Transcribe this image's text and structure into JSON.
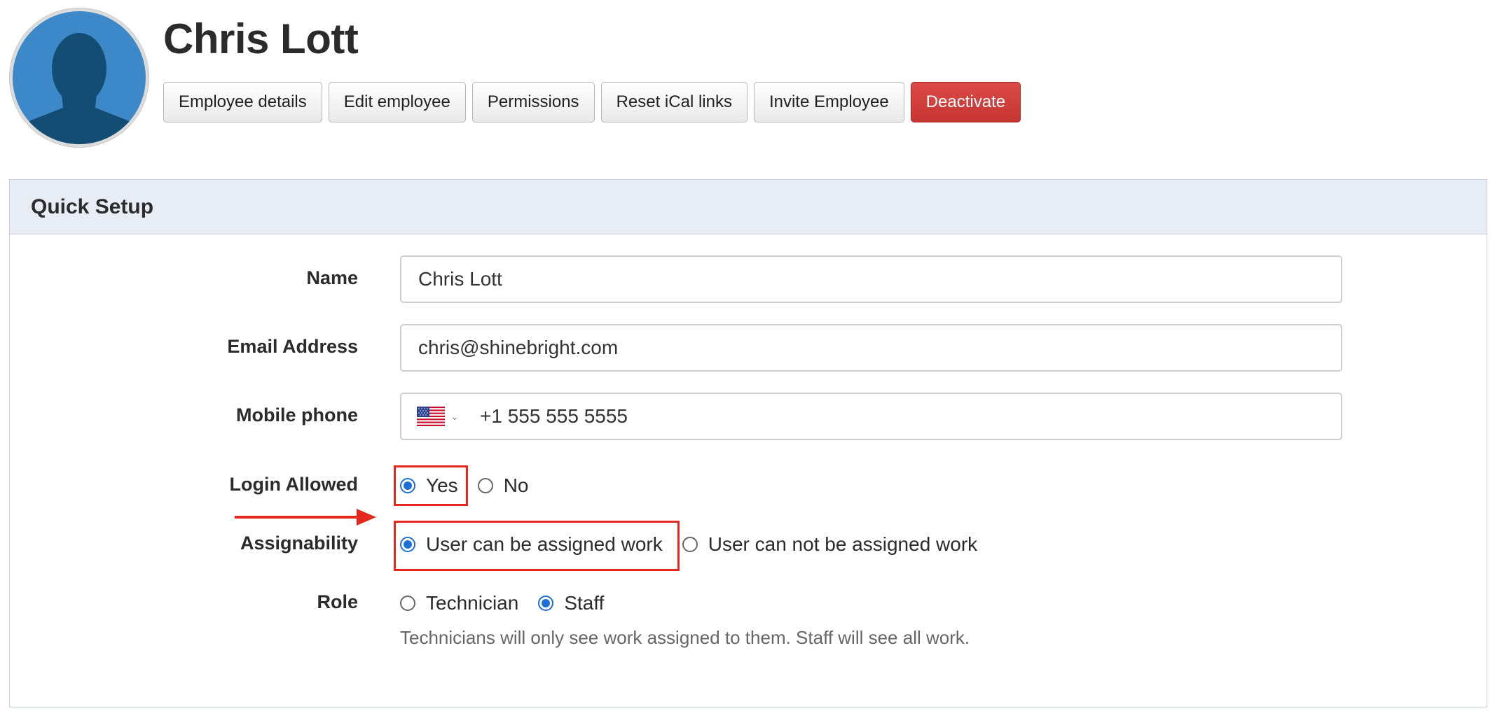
{
  "employee": {
    "name": "Chris Lott"
  },
  "actions": {
    "details": "Employee details",
    "edit": "Edit employee",
    "permissions": "Permissions",
    "reset_ical": "Reset iCal links",
    "invite": "Invite Employee",
    "deactivate": "Deactivate"
  },
  "quick_setup": {
    "title": "Quick Setup",
    "name": {
      "label": "Name",
      "value": "Chris Lott"
    },
    "email": {
      "label": "Email Address",
      "value": "chris@shinebright.com"
    },
    "mobile": {
      "label": "Mobile phone",
      "country_icon": "us-flag-icon",
      "value": "+1 555 555 5555"
    },
    "login": {
      "label": "Login Allowed",
      "options": [
        "Yes",
        "No"
      ],
      "selected": "Yes"
    },
    "assignability": {
      "label": "Assignability",
      "options": [
        "User can be assigned work",
        "User can not be assigned work"
      ],
      "selected": "User can be assigned work"
    },
    "role": {
      "label": "Role",
      "options": [
        "Technician",
        "Staff"
      ],
      "selected": "Staff",
      "help": "Technicians will only see work assigned to them. Staff will see all work."
    }
  },
  "colors": {
    "accent": "#1f6fd9",
    "danger": "#d03b39",
    "annotation": "#e5281e",
    "panel_header": "#e8ecf5"
  }
}
